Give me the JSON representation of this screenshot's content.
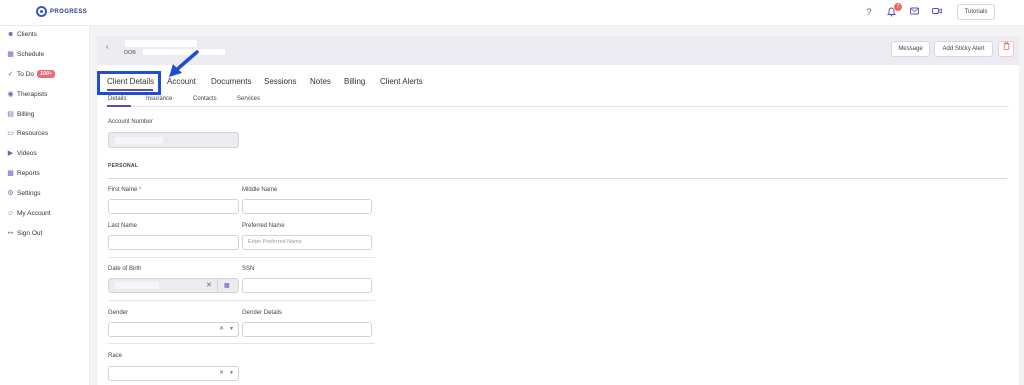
{
  "topbar": {
    "logo_text": "PROGRESS",
    "notification_count": "7",
    "tutorials_label": "Tutorials",
    "icons": [
      "help-icon",
      "bell-icon",
      "mail-icon",
      "video-icon"
    ]
  },
  "sidebar": {
    "items": [
      {
        "label": "Clients",
        "icon": "user-icon"
      },
      {
        "label": "Schedule",
        "icon": "calendar-icon"
      },
      {
        "label": "To Do",
        "icon": "check-circle-icon",
        "badge": "100+"
      },
      {
        "label": "Therapists",
        "icon": "location-icon"
      },
      {
        "label": "Billing",
        "icon": "card-icon"
      },
      {
        "label": "Resources",
        "icon": "folder-icon"
      },
      {
        "label": "Videos",
        "icon": "video-icon"
      },
      {
        "label": "Reports",
        "icon": "bar-chart-icon"
      },
      {
        "label": "Settings",
        "icon": "gear-icon"
      },
      {
        "label": "My Account",
        "icon": "account-circle-icon"
      },
      {
        "label": "Sign Out",
        "icon": "logout-icon"
      }
    ]
  },
  "header": {
    "dob_label": "DOB",
    "message_label": "Message",
    "sticky_alert_label": "Add Sticky Alert"
  },
  "tabs": [
    "Client Details",
    "Account",
    "Documents",
    "Sessions",
    "Notes",
    "Billing",
    "Client Alerts"
  ],
  "subtabs": [
    "Details",
    "Insurance",
    "Contacts",
    "Services"
  ],
  "form": {
    "account_number_label": "Account Number",
    "personal_section": "PERSONAL",
    "first_name_label": "First Name",
    "required_mark": "*",
    "middle_name_label": "Middle Name",
    "last_name_label": "Last Name",
    "preferred_name_label": "Preferred Name",
    "preferred_name_placeholder": "Enter Preferred Name",
    "dob_label": "Date of Birth",
    "ssn_label": "SSN",
    "gender_label": "Gender",
    "gender_details_label": "Gender Details",
    "race_label": "Race"
  },
  "colors": {
    "accent": "#5b4bb8",
    "highlight_box": "#1f4ed6",
    "badge_red": "#ef6a77"
  }
}
